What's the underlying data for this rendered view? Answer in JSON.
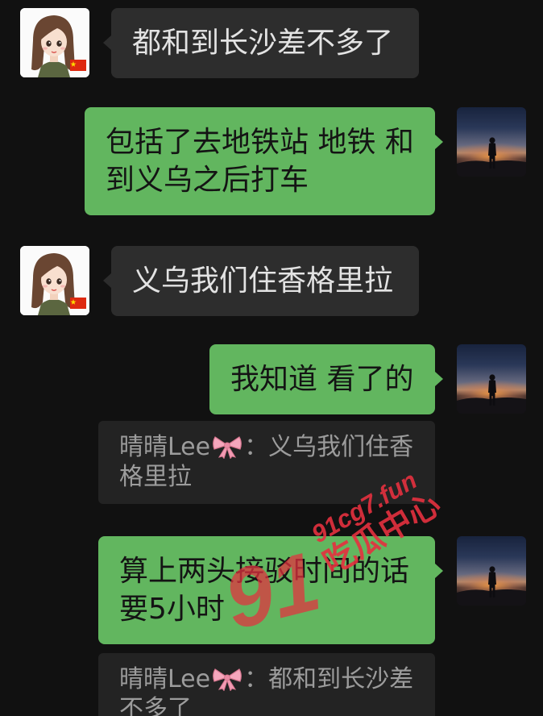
{
  "theme": {
    "background": "#111111",
    "incoming_bubble": "#2d2d2d",
    "incoming_text": "#e3e3e3",
    "outgoing_bubble": "#62b65f",
    "outgoing_text": "#141414",
    "quote_box": "#232323",
    "quote_text": "#9c9c9c",
    "watermark": "#e5313f"
  },
  "avatars": {
    "contact": "cartoon-girl-with-flag-avatar",
    "self": "sunset-silhouette-avatar"
  },
  "messages": [
    {
      "lines": [
        "都和到长沙差不多了"
      ]
    },
    {
      "lines": [
        "包括了去地铁站 地铁 和",
        "到义乌之后打车"
      ]
    },
    {
      "lines": [
        "义乌我们住香格里拉"
      ]
    },
    {
      "lines": [
        "我知道 看了的"
      ],
      "quote": {
        "name": "晴晴Lee",
        "name_icon": "bow-icon",
        "colon": "：",
        "lines": [
          "义乌我们住香",
          "格里拉"
        ]
      }
    },
    {
      "lines": [
        "算上两头接驳时间的话",
        "要5小时"
      ],
      "quote": {
        "name": "晴晴Lee",
        "name_icon": "bow-icon",
        "colon": "：",
        "lines": [
          "都和到长沙差",
          "不多了"
        ]
      }
    }
  ],
  "watermark": {
    "site": "91cg7.fun",
    "name": "吃瓜中心",
    "logo": "91"
  }
}
